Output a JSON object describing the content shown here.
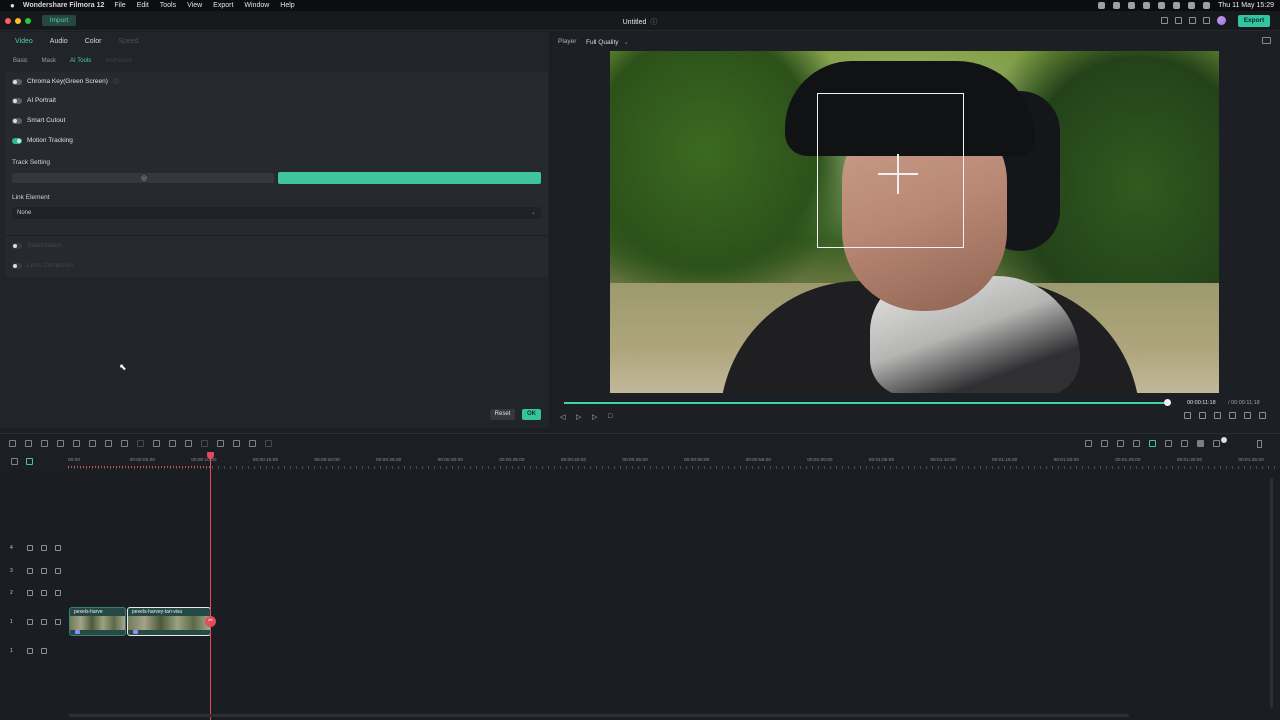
{
  "menubar": {
    "app_name": "Wondershare Filmora 12",
    "items": [
      "File",
      "Edit",
      "Tools",
      "View",
      "Export",
      "Window",
      "Help"
    ],
    "clock": "Thu 11 May  15:29"
  },
  "titlebar": {
    "import_label": "Import",
    "title": "Untitled",
    "export_label": "Export"
  },
  "left_panel": {
    "tabs": [
      "Video",
      "Audio",
      "Color",
      "Speed"
    ],
    "subtabs": [
      "Basic",
      "Mask",
      "AI Tools",
      "Animation"
    ],
    "tools": {
      "chroma_key": "Chroma Key(Green Screen)",
      "ai_portrait": "AI Portrait",
      "smart_cutout": "Smart Cutout",
      "motion_tracking": "Motion Tracking"
    },
    "track_setting_label": "Track Setting",
    "link_element_label": "Link Element",
    "link_element_value": "None",
    "disabled_1": "Stabilization",
    "disabled_2": "Lens Correction",
    "reset_label": "Reset",
    "ok_label": "OK"
  },
  "player": {
    "label": "Player",
    "quality": "Full Quality",
    "progress": 0.993,
    "time_current": "00:00:11:18",
    "time_total": "/ 00:00:11:18"
  },
  "ruler_labels": [
    "00:00",
    "00:00:05:00",
    "00:00:10:00",
    "00:00:15:00",
    "00:00:20:00",
    "00:00:25:00",
    "00:00:30:00",
    "00:00:35:00",
    "00:00:40:00",
    "00:00:45:00",
    "00:00:50:00",
    "00:00:55:00",
    "00:01:00:00",
    "00:01:05:00",
    "00:01:10:00",
    "00:01:15:00",
    "00:01:20:00",
    "00:01:25:00",
    "00:01:30:00",
    "00:01:35:00"
  ],
  "tracks": {
    "v4": "4",
    "v3": "3",
    "v2": "2",
    "v1": "1",
    "a1": "1",
    "clip1_name": "pexels-harve",
    "clip2_name": "pexels-harvey-tan-visu"
  },
  "colors": {
    "accent": "#3ec59b",
    "playhead": "#e24b57"
  }
}
